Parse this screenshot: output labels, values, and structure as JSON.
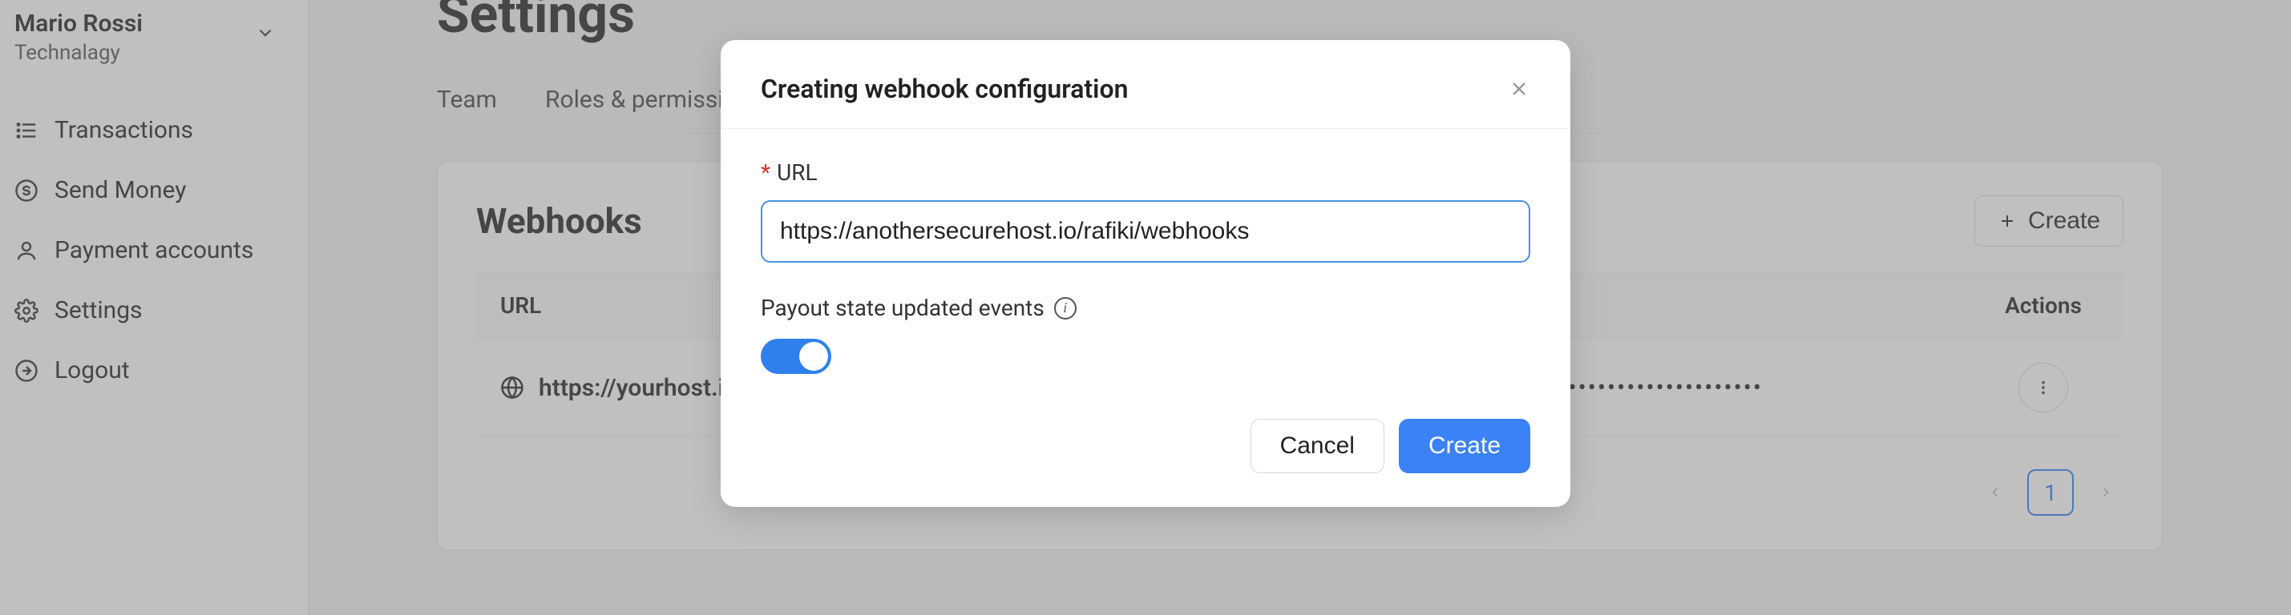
{
  "sidebar": {
    "user_name": "Mario Rossi",
    "user_company": "Technalagy",
    "items": [
      {
        "label": "Transactions",
        "icon": "list-icon"
      },
      {
        "label": "Send Money",
        "icon": "dollar-circle-icon"
      },
      {
        "label": "Payment accounts",
        "icon": "user-icon"
      },
      {
        "label": "Settings",
        "icon": "gear-icon"
      },
      {
        "label": "Logout",
        "icon": "logout-icon"
      }
    ]
  },
  "page": {
    "title": "Settings",
    "tabs": [
      "Team",
      "Roles & permissions"
    ]
  },
  "webhooks": {
    "title": "Webhooks",
    "create_label": "Create",
    "columns": {
      "url": "URL",
      "actions": "Actions"
    },
    "rows": [
      {
        "url": "https://yourhost.io/rafik",
        "secret": "••••••••••••••••••••••••••••••••"
      }
    ],
    "pagination": {
      "current": "1"
    }
  },
  "modal": {
    "title": "Creating webhook configuration",
    "url_label": "URL",
    "url_value": "https://anothersecurehost.io/rafiki/webhooks",
    "switch_label": "Payout state updated events",
    "switch_on": true,
    "cancel_label": "Cancel",
    "create_label": "Create"
  }
}
